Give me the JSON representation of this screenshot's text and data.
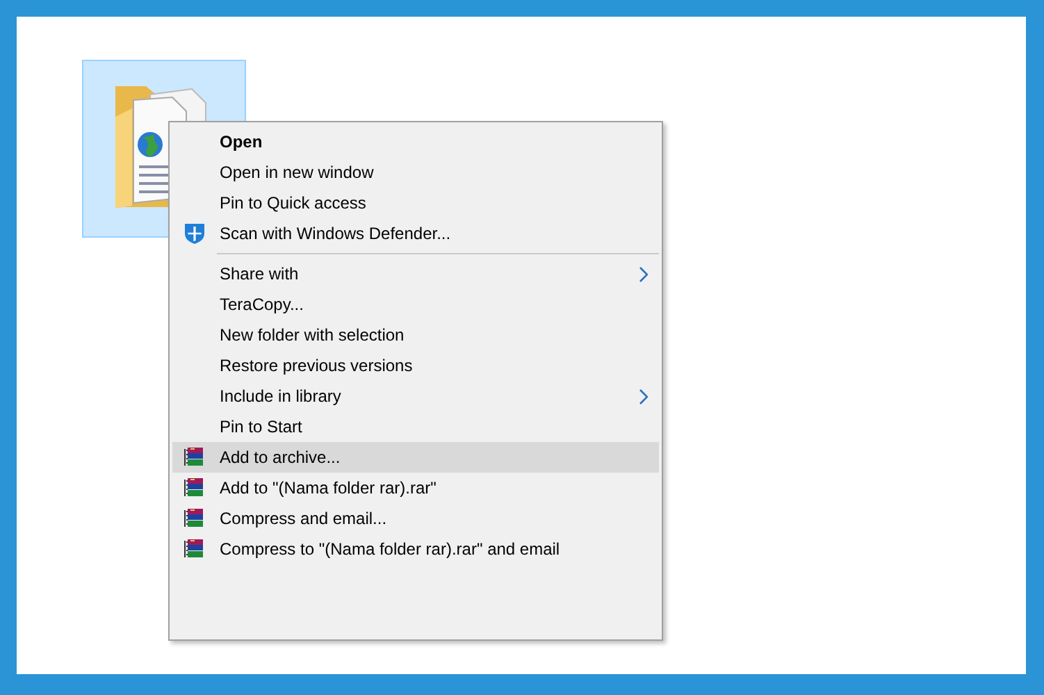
{
  "desktop": {
    "folder": {
      "selected": true
    }
  },
  "context_menu": {
    "items": [
      {
        "kind": "plain",
        "label": "Open",
        "default": true,
        "submenu": false,
        "selected": false
      },
      {
        "kind": "plain",
        "label": "Open in new window",
        "default": false,
        "submenu": false,
        "selected": false
      },
      {
        "kind": "plain",
        "label": "Pin to Quick access",
        "default": false,
        "submenu": false,
        "selected": false
      },
      {
        "kind": "defender",
        "label": "Scan with Windows Defender...",
        "default": false,
        "submenu": false,
        "selected": false
      },
      {
        "kind": "separator"
      },
      {
        "kind": "plain",
        "label": "Share with",
        "default": false,
        "submenu": true,
        "selected": false
      },
      {
        "kind": "plain",
        "label": "TeraCopy...",
        "default": false,
        "submenu": false,
        "selected": false
      },
      {
        "kind": "plain",
        "label": "New folder with selection",
        "default": false,
        "submenu": false,
        "selected": false
      },
      {
        "kind": "plain",
        "label": "Restore previous versions",
        "default": false,
        "submenu": false,
        "selected": false
      },
      {
        "kind": "plain",
        "label": "Include in library",
        "default": false,
        "submenu": true,
        "selected": false
      },
      {
        "kind": "plain",
        "label": "Pin to Start",
        "default": false,
        "submenu": false,
        "selected": false
      },
      {
        "kind": "archive",
        "label": "Add to archive...",
        "default": false,
        "submenu": false,
        "selected": true
      },
      {
        "kind": "archive",
        "label": "Add to \"(Nama folder rar).rar\"",
        "default": false,
        "submenu": false,
        "selected": false
      },
      {
        "kind": "archive",
        "label": "Compress and email...",
        "default": false,
        "submenu": false,
        "selected": false
      },
      {
        "kind": "archive",
        "label": "Compress to \"(Nama folder rar).rar\" and email",
        "default": false,
        "submenu": false,
        "selected": false
      }
    ]
  }
}
